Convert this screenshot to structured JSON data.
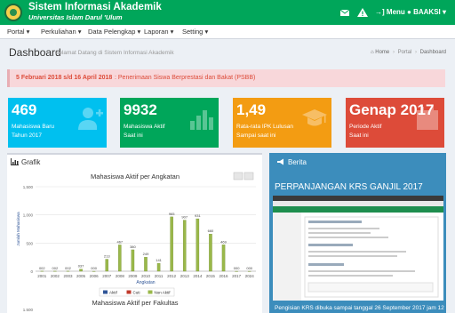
{
  "header": {
    "title": "Sistem Informasi Akademik",
    "subtitle": "Universitas Islam Darul 'Ulum",
    "menu_label": "Menu",
    "user_label": "BAAKSI"
  },
  "nav": {
    "items": [
      {
        "label": "Portal"
      },
      {
        "label": "Perkuliahan"
      },
      {
        "label": "Data Pelengkap"
      },
      {
        "label": "Laporan"
      },
      {
        "label": "Setting"
      }
    ]
  },
  "page": {
    "title": "Dashboard",
    "subtitle": "Selamat Datang di Sistem Informasi Akademik",
    "breadcrumb": [
      "Home",
      "Portal",
      "Dashboard"
    ]
  },
  "alert": {
    "date": "5 Februari 2018 s/d 16 April 2018",
    "text": ": Penerimaan Siswa Berprestasi dan Bakat (PSBB)"
  },
  "stats": [
    {
      "value": "469",
      "label_1": "Mahasiswa Baru",
      "label_2": "Tahun 2017",
      "color": "#00c0ef",
      "icon": "user-add-icon"
    },
    {
      "value": "9932",
      "label_1": "Mahasiswa Aktif",
      "label_2": "Saat ini",
      "color": "#00a65a",
      "icon": "bar-chart-icon"
    },
    {
      "value": "1,49",
      "label_1": "Rata-rata IPK Lulusan",
      "label_2": "Sampai saat ini",
      "color": "#f39c12",
      "icon": "graduation-cap-icon"
    },
    {
      "value": "Genap 2017",
      "label_1": "Periode Aktif",
      "label_2": "Saat ini",
      "color": "#dd4b39",
      "icon": "calendar-icon"
    }
  ],
  "grafik": {
    "heading": "Grafik",
    "second_chart_title": "Mahasiswa Aktif per Fakultas",
    "second_chart_ytick": "1,500"
  },
  "chart_data": {
    "type": "bar",
    "title": "Mahasiswa Aktif per Angkatan",
    "xlabel": "Angkatan",
    "ylabel": "Jumlah Mahasiswa",
    "ylim": [
      0,
      1500
    ],
    "yticks": [
      "0",
      "500",
      "1,000",
      "1,500"
    ],
    "categories": [
      "2001",
      "2002",
      "2003",
      "2005",
      "2006",
      "2007",
      "2008",
      "2009",
      "2010",
      "2011",
      "2012",
      "2013",
      "2014",
      "2015",
      "2016",
      "2017",
      "2024"
    ],
    "series": [
      {
        "name": "Aktif",
        "color": "#2f5597",
        "values": [
          0,
          0,
          0,
          0,
          0,
          0,
          0,
          0,
          0,
          0,
          0,
          0,
          0,
          0,
          0,
          0,
          0
        ]
      },
      {
        "name": "Cuti",
        "color": "#c0392b",
        "values": [
          0,
          0,
          0,
          0,
          0,
          0,
          0,
          0,
          0,
          0,
          0,
          0,
          0,
          0,
          0,
          0,
          0
        ]
      },
      {
        "name": "Non Aktif",
        "color": "#9ab84a",
        "values": [
          2,
          2,
          2,
          37,
          0,
          213,
          467,
          380,
          249,
          141,
          965,
          907,
          931,
          660,
          469,
          0,
          0
        ]
      }
    ],
    "data_labels": [
      "002",
      "002",
      "002",
      "037",
      "000",
      "213",
      "467",
      "380",
      "249",
      "141",
      "965",
      "907",
      "931",
      "660",
      "469",
      "000",
      "000"
    ],
    "legend": "bottom"
  },
  "news": {
    "heading": "Berita",
    "title": "PERPANJANGAN KRS GANJIL 2017",
    "footer": "Pengisian KRS dibuka sampai tanggal 26 September 2017 jam 12"
  }
}
